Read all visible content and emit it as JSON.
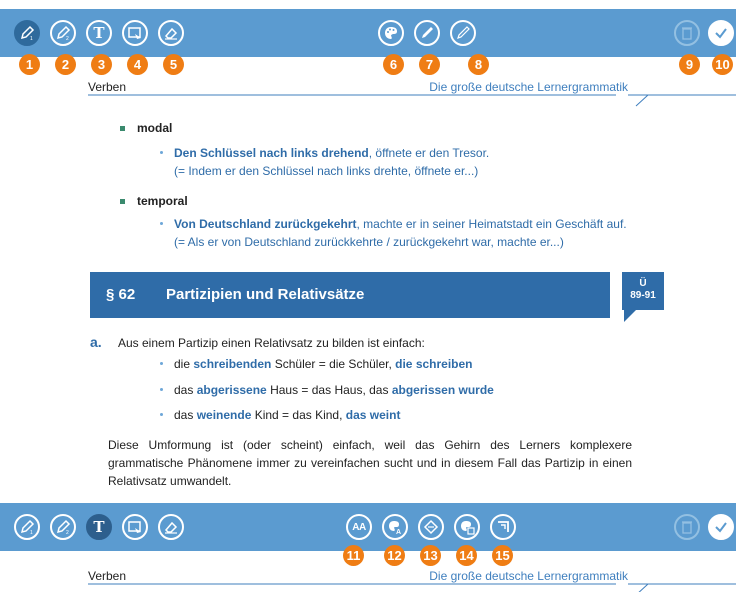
{
  "toolbar_top": {
    "tools_left": [
      {
        "name": "pen-1-icon"
      },
      {
        "name": "pen-2-icon"
      },
      {
        "name": "text-icon",
        "glyph": "T"
      },
      {
        "name": "image-comment-icon"
      },
      {
        "name": "eraser-icon"
      }
    ],
    "tools_center": [
      {
        "name": "color-palette-icon"
      },
      {
        "name": "brush-thick-icon"
      },
      {
        "name": "brush-thin-icon"
      }
    ],
    "tools_right": [
      {
        "name": "trash-icon"
      },
      {
        "name": "confirm-check-icon"
      }
    ],
    "badges": [
      "1",
      "2",
      "3",
      "4",
      "5",
      "6",
      "7",
      "8",
      "9",
      "10"
    ]
  },
  "toolbar_bottom": {
    "text_glyph": "T",
    "aa_glyph": "AA",
    "badges": [
      "11",
      "12",
      "13",
      "14",
      "15"
    ]
  },
  "running_head": {
    "left": "Verben",
    "right": "Die große deutsche Lernergrammatik"
  },
  "body": {
    "modal": {
      "heading": "modal",
      "example_bold": "Den Schlüssel nach links drehend",
      "example_rest": ", öffnete er den Tresor.",
      "paraphrase": "(= Indem er den Schlüssel nach links drehte, öffnete er...)"
    },
    "temporal": {
      "heading": "temporal",
      "example_bold": "Von Deutschland zurückgekehrt",
      "example_rest": ", machte er in seiner Heimatstadt ein Geschäft auf.",
      "paraphrase": "(= Als er von Deutschland zurückkehrte / zurückgekehrt war, machte er...)"
    },
    "section": {
      "number": "§ 62",
      "title": "Partizipien und Relativsätze",
      "ue_label": "Ü",
      "ue_range": "89-91"
    },
    "point_a": {
      "letter": "a.",
      "intro": "Aus einem Partizip einen Relativsatz zu bilden ist einfach:",
      "items": [
        {
          "p1": "die ",
          "p2": "schreibenden",
          "p3": " Schüler = die Schüler, ",
          "p4": "die schreiben"
        },
        {
          "p1": "das ",
          "p2": "abgerissene",
          "p3": " Haus = das Haus, das ",
          "p4": "abgerissen wurde"
        },
        {
          "p1": "das ",
          "p2": "weinende",
          "p3": " Kind = das Kind, ",
          "p4": "das weint"
        }
      ]
    },
    "paragraph": "Diese Umformung ist (oder scheint) einfach, weil das Gehirn des Lerners komplexere grammatische Phänomene immer zu vereinfachen sucht und in diesem Fall das Partizip in einen Relativsatz umwandelt."
  },
  "colors": {
    "toolbar": "#5b9bd0",
    "badge": "#ef7d14",
    "section": "#2f6ca8",
    "accent_text": "#2f6ca8"
  }
}
